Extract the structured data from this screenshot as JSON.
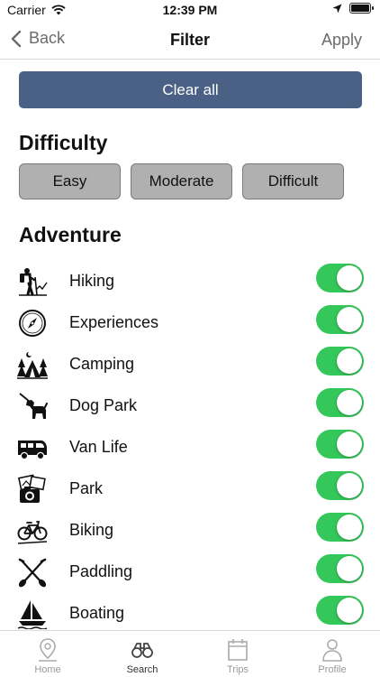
{
  "status_bar": {
    "carrier": "Carrier",
    "time": "12:39 PM"
  },
  "nav": {
    "back_label": "Back",
    "title": "Filter",
    "apply_label": "Apply"
  },
  "clear_all_label": "Clear all",
  "difficulty": {
    "title": "Difficulty",
    "options": [
      "Easy",
      "Moderate",
      "Difficult"
    ]
  },
  "adventure": {
    "title": "Adventure",
    "items": [
      {
        "label": "Hiking",
        "icon": "hiking-icon",
        "enabled": true
      },
      {
        "label": "Experiences",
        "icon": "compass-icon",
        "enabled": true
      },
      {
        "label": "Camping",
        "icon": "tent-icon",
        "enabled": true
      },
      {
        "label": "Dog Park",
        "icon": "dog-icon",
        "enabled": true
      },
      {
        "label": "Van Life",
        "icon": "van-icon",
        "enabled": true
      },
      {
        "label": "Park",
        "icon": "photo-camera-icon",
        "enabled": true
      },
      {
        "label": "Biking",
        "icon": "bike-icon",
        "enabled": true
      },
      {
        "label": "Paddling",
        "icon": "paddles-icon",
        "enabled": true
      },
      {
        "label": "Boating",
        "icon": "sailboat-icon",
        "enabled": true
      }
    ]
  },
  "tabs": [
    {
      "label": "Home",
      "icon": "map-pin-icon",
      "active": false
    },
    {
      "label": "Search",
      "icon": "binoculars-icon",
      "active": true
    },
    {
      "label": "Trips",
      "icon": "calendar-icon",
      "active": false
    },
    {
      "label": "Profile",
      "icon": "person-icon",
      "active": false
    }
  ],
  "colors": {
    "accent": "#4a6185",
    "toggle_on": "#34c759",
    "pill_bg": "#b0b0b0"
  }
}
